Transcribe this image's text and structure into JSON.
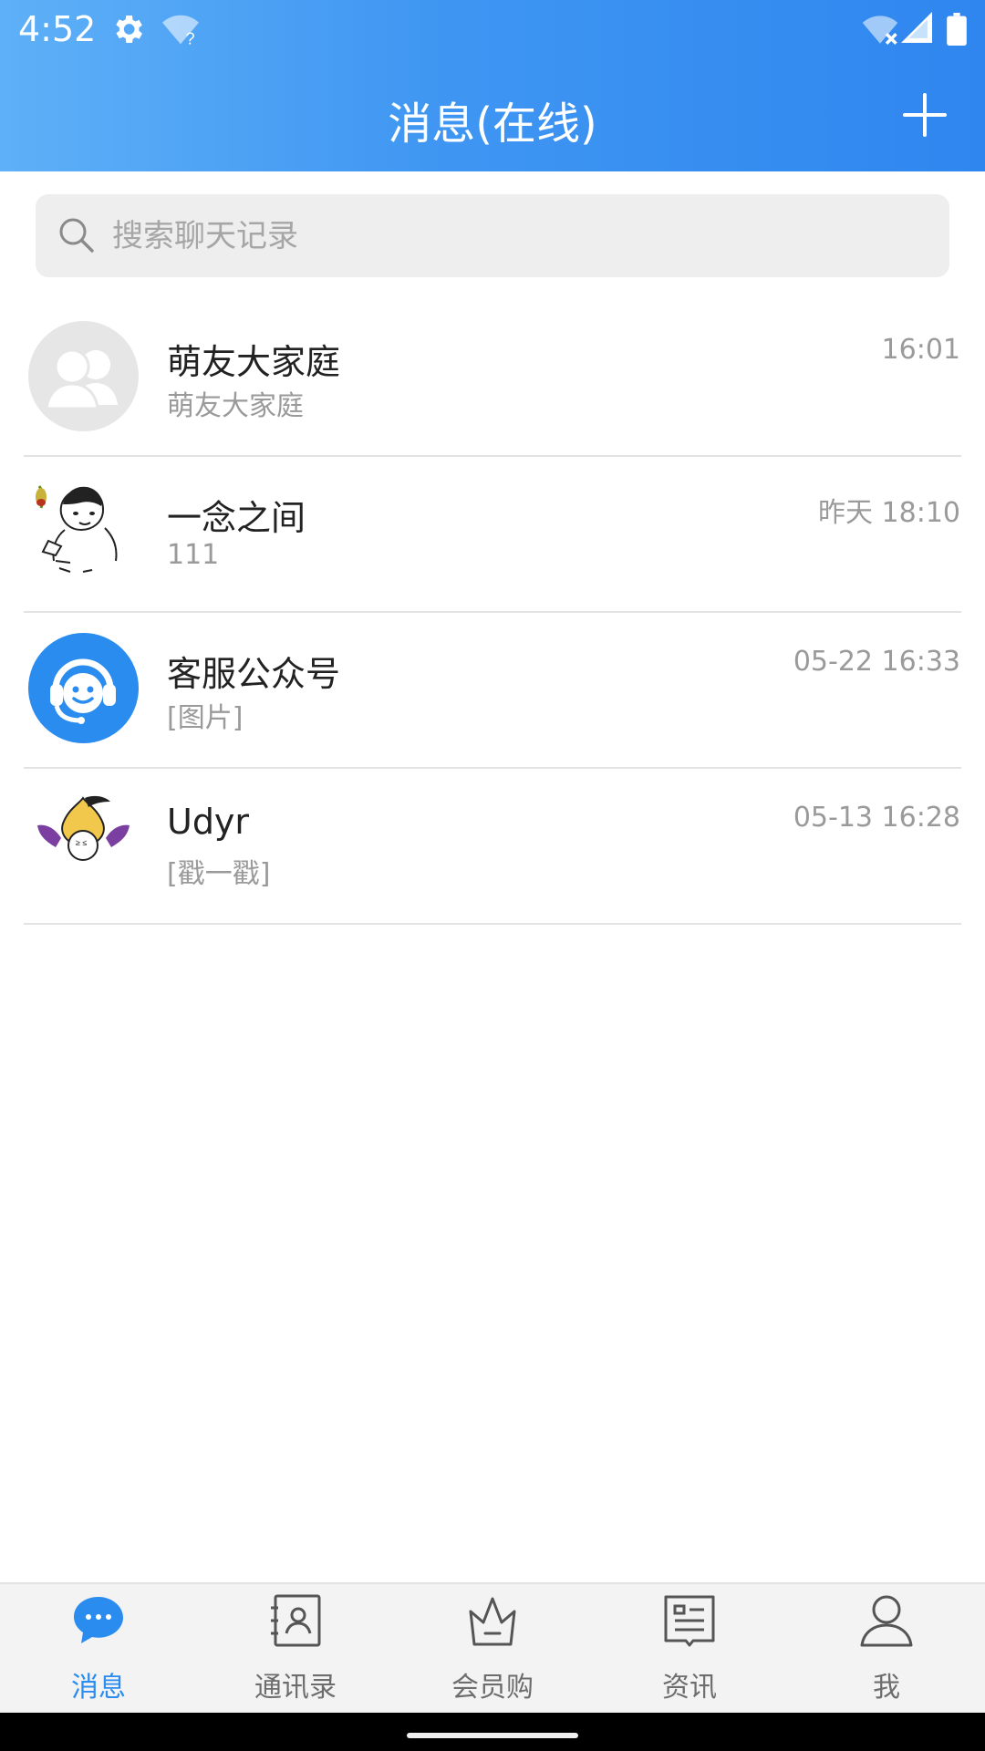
{
  "status_bar": {
    "time": "4:52"
  },
  "header": {
    "title": "消息(在线)"
  },
  "search": {
    "placeholder": "搜索聊天记录"
  },
  "conversations": [
    {
      "name": "萌友大家庭",
      "preview": "萌友大家庭",
      "time": "16:01",
      "avatar": "group-avatar-icon"
    },
    {
      "name": "一念之间",
      "preview": "111",
      "time": "昨天 18:10",
      "avatar": "meme-face-avatar"
    },
    {
      "name": "客服公众号",
      "preview": "[图片]",
      "time": "05-22 16:33",
      "avatar": "customer-service-avatar"
    },
    {
      "name": "Udyr",
      "preview": "[戳一戳]",
      "time": "05-13 16:28",
      "avatar": "cartoon-avatar"
    }
  ],
  "tabs": [
    {
      "label": "消息",
      "icon": "chat-bubble-icon",
      "active": true
    },
    {
      "label": "通讯录",
      "icon": "contacts-icon",
      "active": false
    },
    {
      "label": "会员购",
      "icon": "crown-icon",
      "active": false
    },
    {
      "label": "资讯",
      "icon": "news-icon",
      "active": false
    },
    {
      "label": "我",
      "icon": "person-icon",
      "active": false
    }
  ],
  "colors": {
    "accent": "#2b8cf0",
    "header_start": "#5eb0f7",
    "header_end": "#2f86ef"
  }
}
